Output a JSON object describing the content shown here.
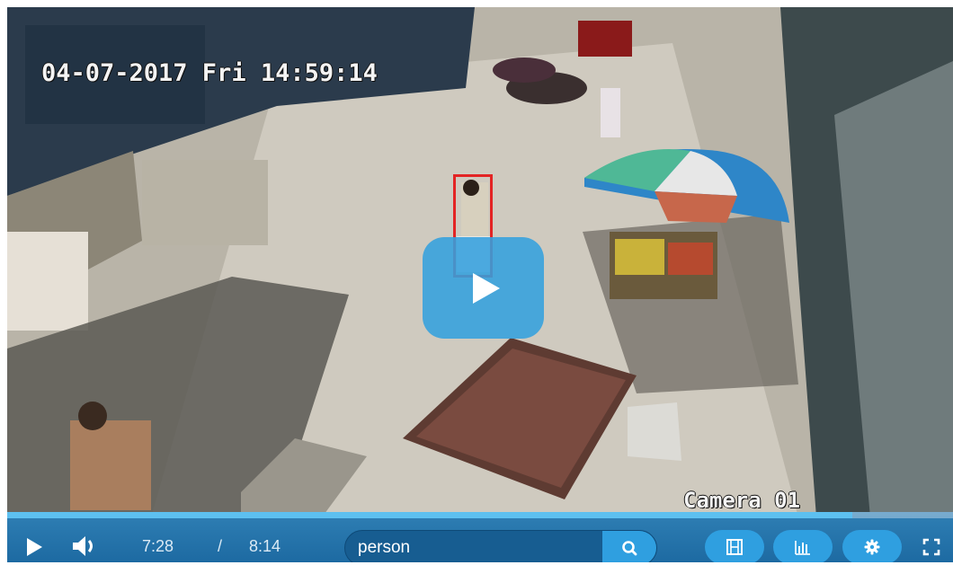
{
  "video": {
    "overlay_timestamp": "04-07-2017 Fri 14:59:14",
    "overlay_camera": "Camera 01",
    "progress_fraction": 0.894
  },
  "controls": {
    "play_icon": "play-icon",
    "volume_icon": "volume-icon",
    "current_time": "7:28",
    "time_separator": "/",
    "duration": "8:14",
    "search": {
      "value": "person",
      "icon": "search-icon"
    },
    "buttons": [
      {
        "icon": "film-icon"
      },
      {
        "icon": "bar-chart-icon"
      },
      {
        "icon": "gear-icon"
      }
    ],
    "fullscreen_icon": "fullscreen-icon"
  },
  "colors": {
    "control_bar": "#1d6aa2",
    "accent": "#2f9fe0",
    "detection_box": "#e32424"
  }
}
